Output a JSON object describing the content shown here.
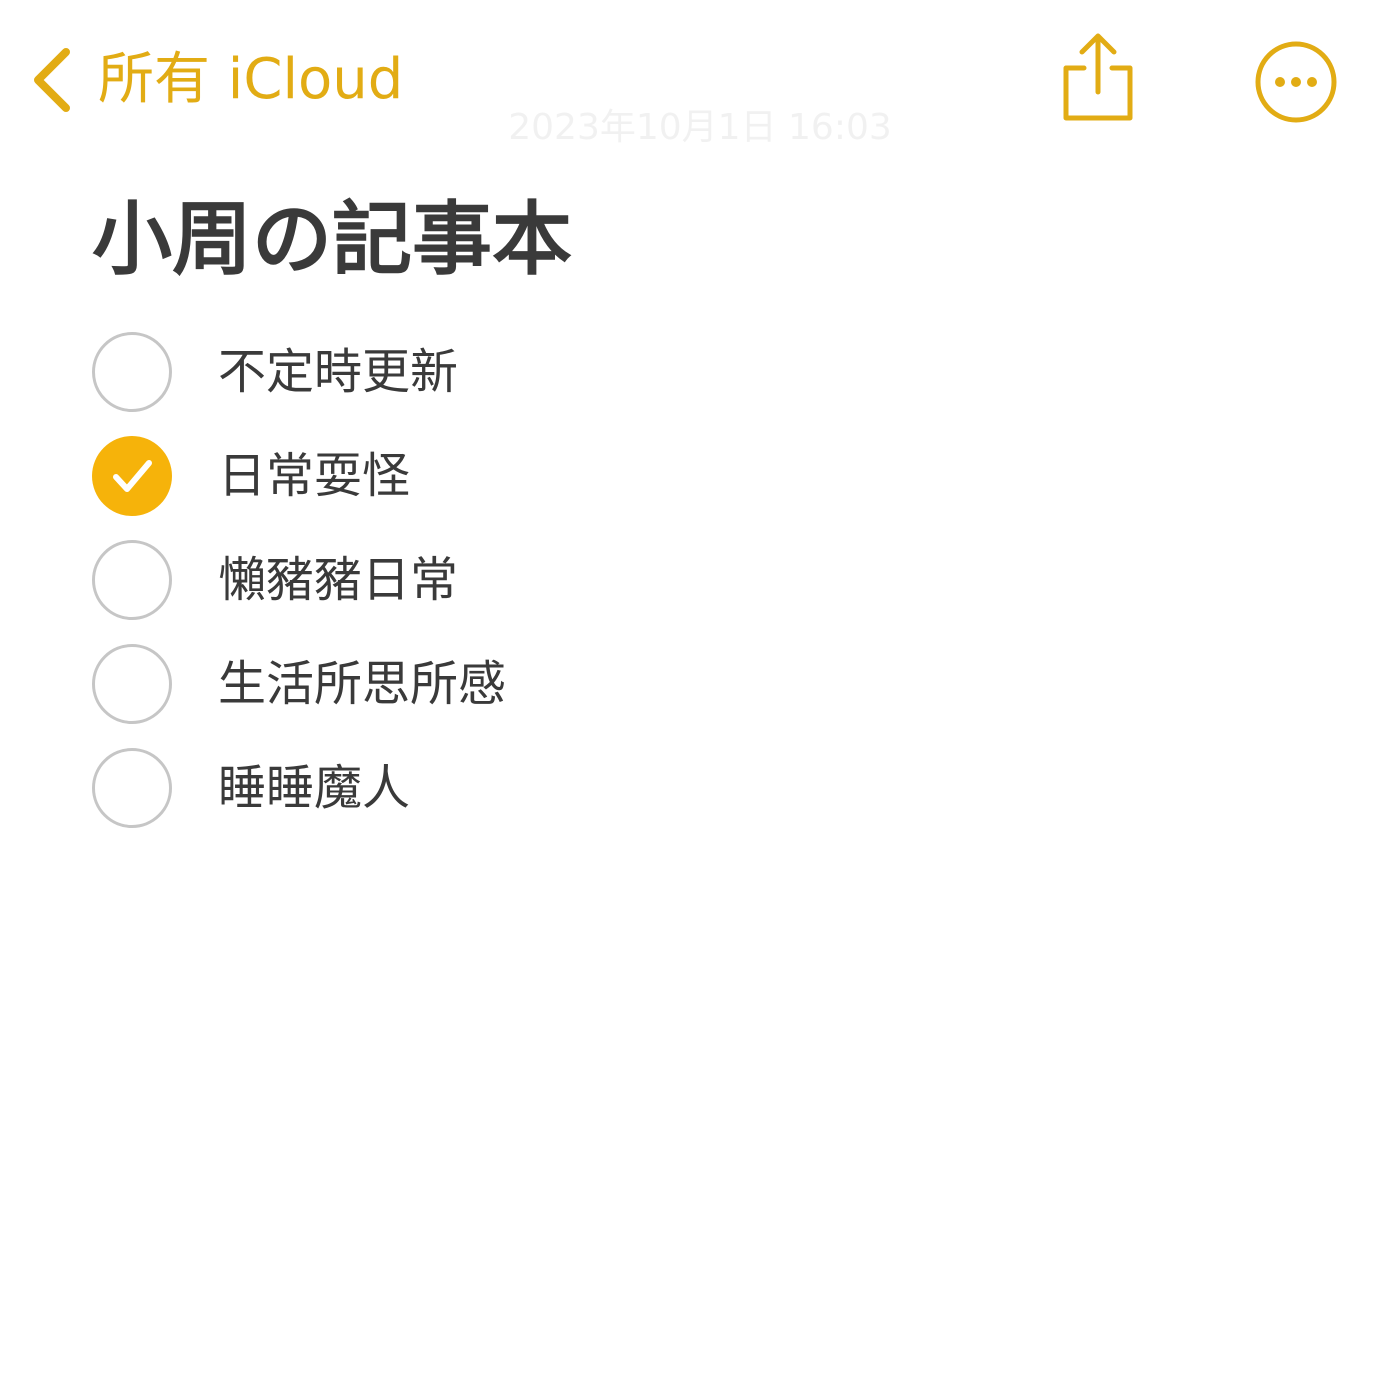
{
  "nav": {
    "back_label": "所有 iCloud",
    "back_icon": "chevron-left-icon",
    "share_icon": "share-icon",
    "more_icon": "ellipsis-circle-icon"
  },
  "note": {
    "timestamp": "2023年10月1日 16:03",
    "title": "小周の記事本",
    "checklist": [
      {
        "label": "不定時更新",
        "checked": false
      },
      {
        "label": "日常耍怪",
        "checked": true
      },
      {
        "label": "懶豬豬日常",
        "checked": false
      },
      {
        "label": "生活所思所感",
        "checked": false
      },
      {
        "label": "睡睡魔人",
        "checked": false
      }
    ]
  },
  "colors": {
    "accent": "#e2ac14",
    "check_fill": "#f6b30a",
    "text": "#3a3a3a",
    "unchecked_ring": "#c6c6c6",
    "background": "#ffffff"
  }
}
